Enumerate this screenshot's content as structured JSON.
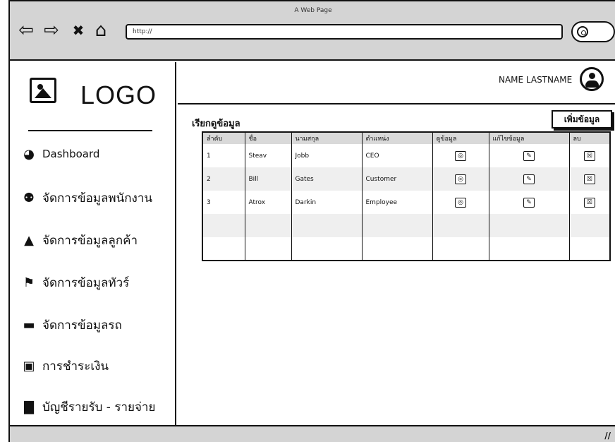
{
  "browser": {
    "page_title": "A Web Page",
    "url": "http://",
    "nav": {
      "back_glyph": "⇦",
      "forward_glyph": "⇨",
      "stop_glyph": "✖",
      "home_glyph": "⌂"
    }
  },
  "sidebar": {
    "logo_text": "LOGO",
    "items": [
      {
        "label": "Dashboard",
        "icon": "dashboard-icon",
        "glyph": "◕"
      },
      {
        "label": "จัดการข้อมูลพนักงาน",
        "icon": "users-icon",
        "glyph": "⚉"
      },
      {
        "label": "จัดการข้อมูลลูกค้า",
        "icon": "user-icon",
        "glyph": "▲"
      },
      {
        "label": "จัดการข้อมูลทัวร์",
        "icon": "flag-icon",
        "glyph": "⚑"
      },
      {
        "label": "จัดการข้อมูลรถ",
        "icon": "car-icon",
        "glyph": "▬"
      },
      {
        "label": "การชำระเงิน",
        "icon": "money-icon",
        "glyph": "▣"
      },
      {
        "label": "บัญชีรายรับ - รายจ่าย",
        "icon": "bar-chart-icon",
        "glyph": "▇"
      }
    ]
  },
  "header": {
    "user_name": "NAME LASTNAME"
  },
  "main": {
    "section_title": "เรียกดูข้อมูล",
    "add_button_label": "เพิ่มข้อมูล",
    "table": {
      "columns": [
        "ลำดับ",
        "ชื่อ",
        "นามสกุล",
        "ตำแหน่ง",
        "ดูข้อมูล",
        "แก้ไขข้อมูล",
        "ลบ"
      ],
      "rows": [
        {
          "no": "1",
          "first": "Steav",
          "last": "Jobb",
          "position": "CEO"
        },
        {
          "no": "2",
          "first": "Bill",
          "last": "Gates",
          "position": "Customer"
        },
        {
          "no": "3",
          "first": "Atrox",
          "last": "Darkin",
          "position": "Employee"
        },
        {
          "no": "",
          "first": "",
          "last": "",
          "position": ""
        },
        {
          "no": "",
          "first": "",
          "last": "",
          "position": ""
        }
      ],
      "view_glyph": "◎",
      "edit_glyph": "✎",
      "delete_glyph": "☒"
    }
  },
  "status": {
    "grip_glyph": "//"
  }
}
